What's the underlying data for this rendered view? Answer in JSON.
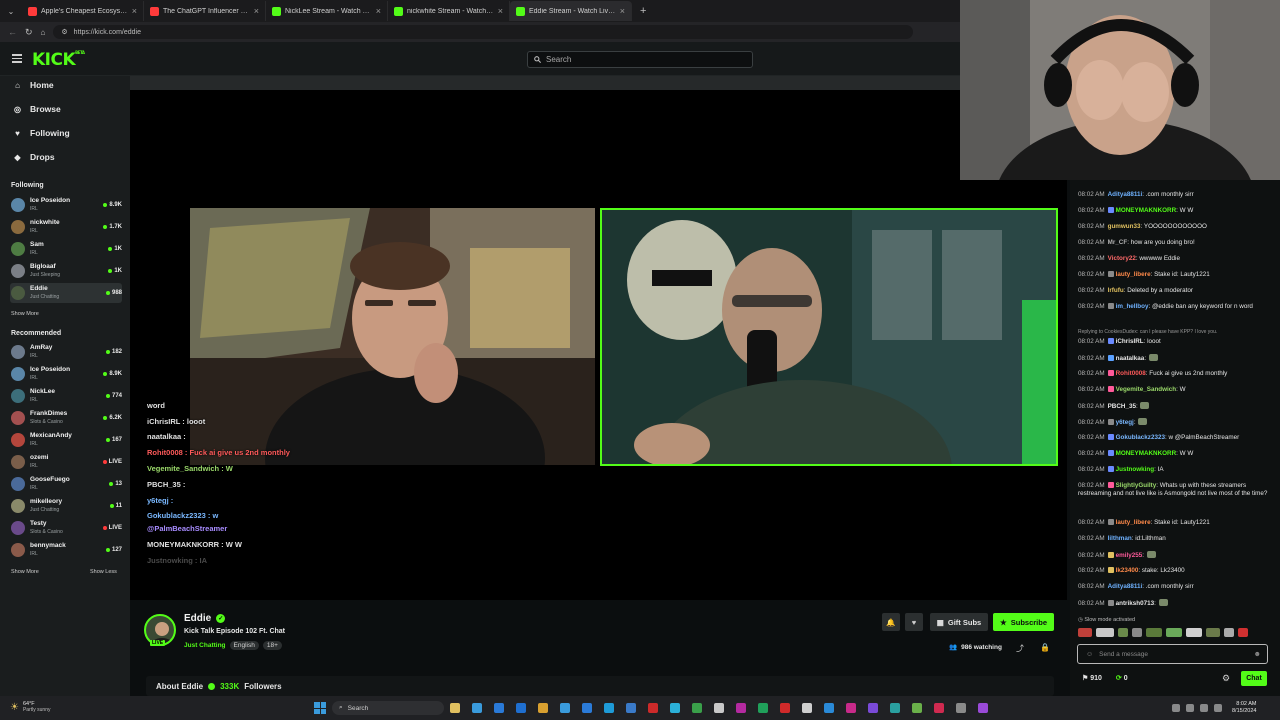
{
  "browser": {
    "tabs": [
      {
        "title": "Apple's Cheapest Ecosystem Bri",
        "color": "#ff3b3b"
      },
      {
        "title": "The ChatGPT Influencer Trip Just",
        "color": "#ff3b3b"
      },
      {
        "title": "NickLee Stream - Watch Live",
        "color": "#53fc18"
      },
      {
        "title": "nickwhite Stream - Watch Live",
        "color": "#53fc18"
      },
      {
        "title": "Eddie Stream - Watch Live on",
        "color": "#53fc18"
      }
    ],
    "url": "https://kick.com/eddie"
  },
  "header": {
    "logo": "KICK",
    "logo_sup": "BETA",
    "search_placeholder": "Search"
  },
  "sidebar": {
    "nav": [
      {
        "label": "Home",
        "icon": "home-icon"
      },
      {
        "label": "Browse",
        "icon": "compass-icon"
      },
      {
        "label": "Following",
        "icon": "heart-icon"
      },
      {
        "label": "Drops",
        "icon": "drops-icon"
      }
    ],
    "following_title": "Following",
    "following": [
      {
        "name": "Ice Poseidon",
        "category": "IRL",
        "viewers": "8.9K",
        "live": true,
        "color": "#5a86a8"
      },
      {
        "name": "nickwhite",
        "category": "IRL",
        "viewers": "1.7K",
        "live": true,
        "color": "#8a6a3e"
      },
      {
        "name": "Sam",
        "category": "IRL",
        "viewers": "1K",
        "live": true,
        "color": "#4e7c43"
      },
      {
        "name": "Bigloaaf",
        "category": "Just Sleeping",
        "viewers": "1K",
        "live": true,
        "color": "#7b7f86"
      },
      {
        "name": "Eddie",
        "category": "Just Chatting",
        "viewers": "988",
        "live": true,
        "color": "#4a5a40"
      }
    ],
    "show_more": "Show More",
    "recommended_title": "Recommended",
    "recommended": [
      {
        "name": "AmRay",
        "category": "IRL",
        "viewers": "182",
        "live": true,
        "color": "#6c7a8c"
      },
      {
        "name": "Ice Poseidon",
        "category": "IRL",
        "viewers": "8.9K",
        "live": true,
        "color": "#5a86a8"
      },
      {
        "name": "NickLee",
        "category": "IRL",
        "viewers": "774",
        "live": true,
        "color": "#3c6e7a"
      },
      {
        "name": "FrankDimes",
        "category": "Slots & Casino",
        "viewers": "6.2K",
        "live": true,
        "color": "#a35050"
      },
      {
        "name": "MexicanAndy",
        "category": "IRL",
        "viewers": "167",
        "live": true,
        "color": "#b4463c"
      },
      {
        "name": "ozemi",
        "category": "IRL",
        "viewers": "LIVE",
        "live": false,
        "color": "#7a5e4a"
      },
      {
        "name": "GooseFuego",
        "category": "IRL",
        "viewers": "13",
        "live": true,
        "color": "#4a6a9a"
      },
      {
        "name": "mikelleory",
        "category": "Just Chatting",
        "viewers": "11",
        "live": true,
        "color": "#8a8a6a"
      },
      {
        "name": "Testy",
        "category": "Slots & Casino",
        "viewers": "LIVE",
        "live": false,
        "color": "#6a4a8a"
      },
      {
        "name": "bennymack",
        "category": "IRL",
        "viewers": "127",
        "live": true,
        "color": "#8a5a4a"
      }
    ],
    "show_more2": "Show More",
    "show_less": "Show Less"
  },
  "overlay_chat": [
    {
      "text": "word",
      "color": "#e0e0e0"
    },
    {
      "text": "iChrisIRL : looot",
      "color": "#e0e0e0"
    },
    {
      "text": "naatalkaa :",
      "color": "#e0e0e0"
    },
    {
      "text": "Rohit0008 : Fuck ai give us 2nd monthly",
      "color": "#ff5a5a"
    },
    {
      "text": "Vegemite_Sandwich : W",
      "color": "#9ad86a"
    },
    {
      "text": "PBCH_35 :",
      "color": "#e0e0e0"
    },
    {
      "text": "y6tegj :",
      "color": "#7ab8ff"
    },
    {
      "text": "Gokublackz2323 : w",
      "color": "#7ab8ff"
    },
    {
      "text": "@PalmBeachStreamer",
      "color": "#a88cff"
    },
    {
      "text": "MONEYMAKNKORR : W      W",
      "color": "#e0e0e0"
    },
    {
      "text": "Justnowking : IA",
      "color": "#4a4a4a"
    }
  ],
  "chat": [
    {
      "time": "08:02 AM",
      "user": "Aditya8811i",
      "ucolor": "#6fb2ff",
      "text": ".com monthly sirr",
      "badges": []
    },
    {
      "time": "08:02 AM",
      "user": "MONEYMAKNKORR",
      "ucolor": "#53fc18",
      "text": "W      W",
      "badges": [
        "#6a8aff"
      ]
    },
    {
      "time": "08:02 AM",
      "user": "gumwun33",
      "ucolor": "#e0c060",
      "text": "YOOOOOOOOOOOO",
      "badges": []
    },
    {
      "time": "08:02 AM",
      "user": "Mr_CF",
      "ucolor": "#b0b0b0",
      "text": "how are you doing bro!",
      "badges": []
    },
    {
      "time": "08:02 AM",
      "user": "Victory22",
      "ucolor": "#ff6a6a",
      "text": "wwwww Eddie",
      "badges": []
    },
    {
      "time": "08:02 AM",
      "user": "lauty_libere",
      "ucolor": "#ff8a4a",
      "text": "Stake id: Lauty1221",
      "badges": [
        "#8a8a8a"
      ]
    },
    {
      "time": "08:02 AM",
      "user": "lrfufu",
      "ucolor": "#e0c060",
      "text": "Deleted by a moderator",
      "badges": []
    },
    {
      "time": "08:02 AM",
      "user": "im_hellboy",
      "ucolor": "#6fb2ff",
      "text": "@eddie ban any keyword for n word",
      "badges": [
        "#8a8a8a"
      ]
    },
    {
      "time": "",
      "user": "",
      "ucolor": "#9a9a9a",
      "text": "Replying to CookiesDudex: can I please have KPP? I love you.",
      "badges": []
    },
    {
      "time": "08:02 AM",
      "user": "iChrisIRL",
      "ucolor": "#e6e6e6",
      "text": "looot",
      "badges": [
        "#6a8aff"
      ]
    },
    {
      "time": "08:02 AM",
      "user": "naatalkaa",
      "ucolor": "#e6e6e6",
      "text": "",
      "badges": [
        "#5aa0ff"
      ]
    },
    {
      "time": "08:02 AM",
      "user": "Rohit0008",
      "ucolor": "#ff5a5a",
      "text": "Fuck ai give us 2nd monthly",
      "badges": [
        "#ff5a9a"
      ]
    },
    {
      "time": "08:02 AM",
      "user": "Vegemite_Sandwich",
      "ucolor": "#9ad86a",
      "text": "W",
      "badges": [
        "#ff5a9a"
      ]
    },
    {
      "time": "08:02 AM",
      "user": "PBCH_35",
      "ucolor": "#e6e6e6",
      "text": "",
      "badges": []
    },
    {
      "time": "08:02 AM",
      "user": "y6tegj",
      "ucolor": "#7ab8ff",
      "text": "",
      "badges": [
        "#8a8a8a"
      ]
    },
    {
      "time": "08:02 AM",
      "user": "Gokublackz2323",
      "ucolor": "#7ab8ff",
      "text": "w @PalmBeachStreamer",
      "badges": [
        "#6a8aff"
      ]
    },
    {
      "time": "08:02 AM",
      "user": "MONEYMAKNKORR",
      "ucolor": "#53fc18",
      "text": "W      W",
      "badges": [
        "#6a8aff"
      ]
    },
    {
      "time": "08:02 AM",
      "user": "Justnowking",
      "ucolor": "#53fc18",
      "text": "IA",
      "badges": [
        "#6a8aff"
      ]
    },
    {
      "time": "08:02 AM",
      "user": "SlightlyGuilty",
      "ucolor": "#9ad86a",
      "text": "Whats up with these streamers restreaming and not live like is Asmongold not live most of the time?",
      "badges": [
        "#ff5a9a"
      ]
    },
    {
      "time": "08:02 AM",
      "user": "lauty_libere",
      "ucolor": "#ff8a4a",
      "text": "Stake id: Lauty1221",
      "badges": [
        "#8a8a8a"
      ]
    },
    {
      "time": "08:02 AM",
      "user": "lilthman",
      "ucolor": "#6fb2ff",
      "text": "id:Lilthman",
      "badges": []
    },
    {
      "time": "08:02 AM",
      "user": "emily255",
      "ucolor": "#ff5a9a",
      "text": "",
      "badges": [
        "#e0c060"
      ]
    },
    {
      "time": "08:02 AM",
      "user": "lk23400",
      "ucolor": "#ff8a4a",
      "text": "stake: Lk23400",
      "badges": [
        "#e0c060"
      ]
    },
    {
      "time": "08:02 AM",
      "user": "Aditya8811i",
      "ucolor": "#6fb2ff",
      "text": ".com monthly sirr",
      "badges": []
    },
    {
      "time": "08:02 AM",
      "user": "antriksh0713",
      "ucolor": "#e6e6e6",
      "text": "",
      "badges": [
        "#8a8a8a"
      ]
    }
  ],
  "chat_status": "Slow mode activated",
  "chat_placeholder": "Send a message",
  "chat_button": "Chat",
  "chat_points": "910",
  "chat_points2": "0",
  "stream": {
    "streamer": "Eddie",
    "title": "Kick Talk Episode 102 Ft. Chat",
    "category": "Just Chatting",
    "tags": [
      "English",
      "18+"
    ],
    "gift_subs": "Gift Subs",
    "subscribe": "Subscribe",
    "watching": "986 watching",
    "about": "About Eddie",
    "followers": "333K",
    "followers_label": "Followers"
  },
  "taskbar": {
    "weather_temp": "64°F",
    "weather_desc": "Partly sunny",
    "search": "Search",
    "time": "8:02 AM",
    "date": "8/15/2024"
  },
  "colors": {
    "accent": "#53fc18",
    "bg": "#0b0e0f",
    "sidebar": "#1a1d1e"
  }
}
